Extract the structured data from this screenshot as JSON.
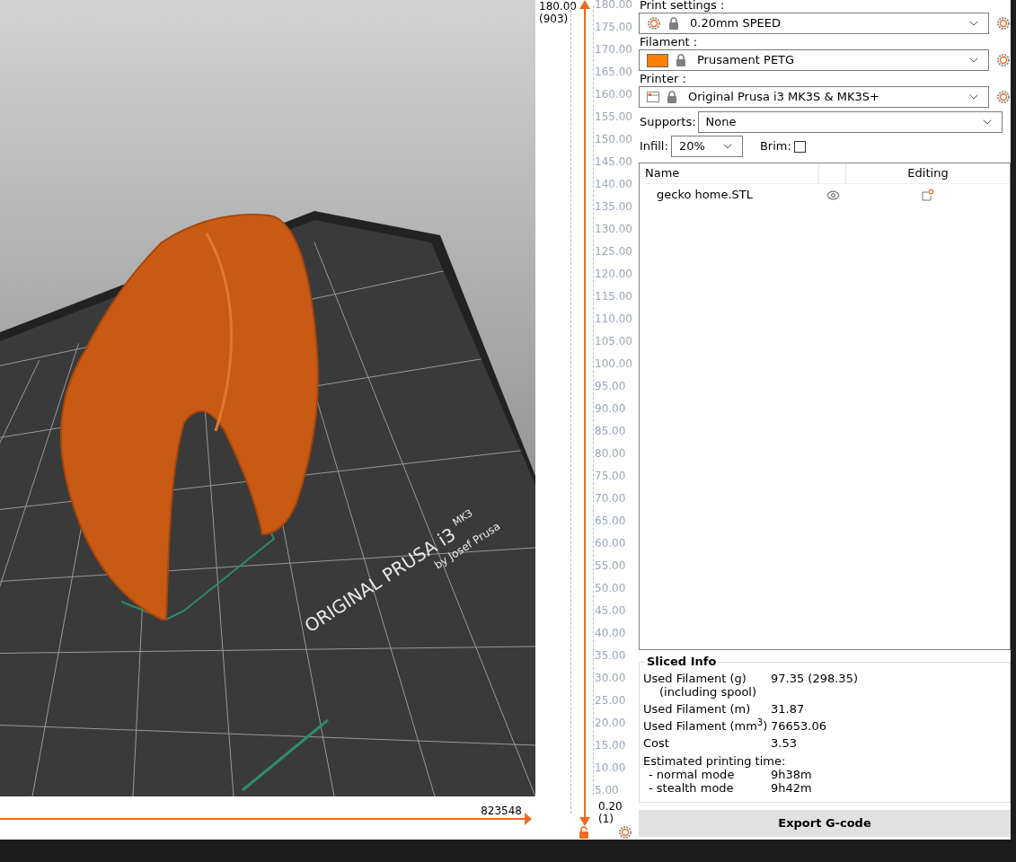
{
  "viewport": {
    "bed_label": [
      "ORIGINAL PRUSA i3",
      "MK3",
      "by Josef Prusa"
    ]
  },
  "horizontal_slider": {
    "value": "823548"
  },
  "vertical_slider": {
    "top_value": "180.00",
    "top_layer": "(903)",
    "bottom_value": "0.20",
    "bottom_layer": "(1)",
    "scale": [
      "180.00",
      "175.00",
      "170.00",
      "165.00",
      "160.00",
      "155.00",
      "150.00",
      "145.00",
      "140.00",
      "135.00",
      "130.00",
      "125.00",
      "120.00",
      "115.00",
      "110.00",
      "105.00",
      "100.00",
      "95.00",
      "90.00",
      "85.00",
      "80.00",
      "75.00",
      "70.00",
      "65.00",
      "60.00",
      "55.00",
      "50.00",
      "45.00",
      "40.00",
      "35.00",
      "30.00",
      "25.00",
      "20.00",
      "15.00",
      "10.00",
      "5.00"
    ]
  },
  "presets": [
    {
      "kind": "print",
      "label": "Print settings :",
      "value": "0.20mm SPEED"
    },
    {
      "kind": "filament",
      "label": "Filament :",
      "value": "Prusament PETG",
      "color": "#ff8000"
    },
    {
      "kind": "printer",
      "label": "Printer :",
      "value": "Original Prusa i3 MK3S & MK3S+"
    }
  ],
  "supports": {
    "label": "Supports:",
    "value": "None"
  },
  "infill": {
    "label": "Infill:",
    "value": "20%"
  },
  "brim": {
    "label": "Brim:",
    "checked": false
  },
  "object_list": {
    "columns": [
      "Name",
      "Editing"
    ],
    "rows": [
      {
        "name": "gecko home.STL"
      }
    ]
  },
  "sliced_info": {
    "title": "Sliced Info",
    "rows": [
      {
        "label": "Used Filament (g)",
        "sublabel": "(including spool)",
        "value": "97.35 (298.35)"
      },
      {
        "label": "Used Filament (m)",
        "value": "31.87"
      },
      {
        "label": "Used Filament (mm$^{3}$)",
        "value": "76653.06"
      },
      {
        "label": "Cost",
        "value": "3.53"
      }
    ],
    "time": {
      "label": "Estimated printing time:",
      "modes": [
        {
          "label": "- normal mode",
          "value": "9h38m"
        },
        {
          "label": "- stealth mode",
          "value": "9h42m"
        }
      ]
    }
  },
  "export_button": "Export G-code"
}
